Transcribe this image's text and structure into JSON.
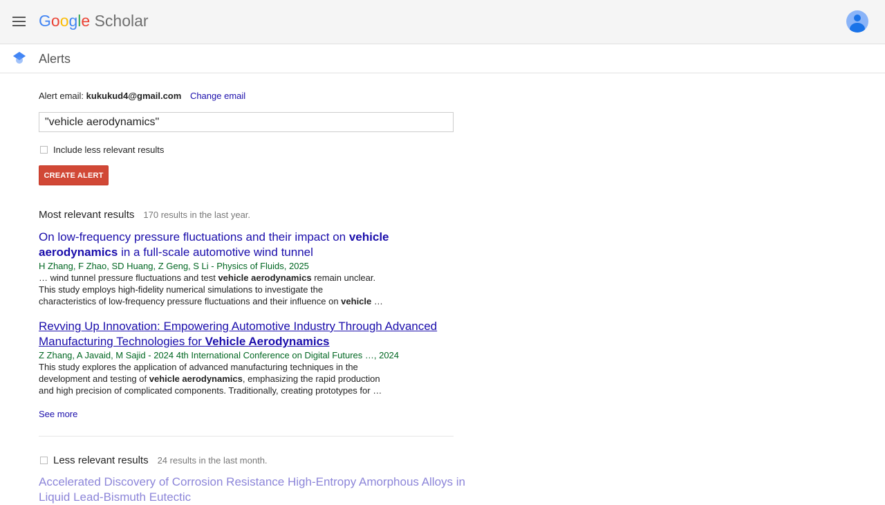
{
  "header": {
    "logo_google": [
      "G",
      "o",
      "o",
      "g",
      "l",
      "e"
    ],
    "logo_colors": [
      "#4285f4",
      "#ea4335",
      "#fbbc05",
      "#4285f4",
      "#34a853",
      "#ea4335"
    ],
    "logo_scholar": "Scholar"
  },
  "subheader": {
    "title": "Alerts"
  },
  "alert": {
    "email_label": "Alert email:",
    "email": "kukukud4@gmail.com",
    "change_email": "Change email",
    "query": "\"vehicle aerodynamics\"",
    "include_less_label": "Include less relevant results",
    "include_less_checked": false,
    "create_button": "CREATE ALERT"
  },
  "most_relevant": {
    "heading": "Most relevant results",
    "count": "170 results in the last year.",
    "results": [
      {
        "title_parts": [
          {
            "text": "On low-frequency pressure fluctuations and their impact on ",
            "bold": false
          },
          {
            "text": "vehicle aerodynamics",
            "bold": true
          },
          {
            "text": " in a full-scale automotive wind tunnel",
            "bold": false
          }
        ],
        "authors": "H Zhang, F Zhao, SD Huang, Z Geng, S Li - Physics of Fluids, 2025",
        "snippet_lines": [
          [
            {
              "text": "… wind tunnel pressure fluctuations and test ",
              "bold": false
            },
            {
              "text": "vehicle aerodynamics",
              "bold": true
            },
            {
              "text": " remain unclear.",
              "bold": false
            }
          ],
          [
            {
              "text": "This study employs high-fidelity numerical simulations to investigate the",
              "bold": false
            }
          ],
          [
            {
              "text": "characteristics of low-frequency pressure fluctuations and their influence on ",
              "bold": false
            },
            {
              "text": "vehicle",
              "bold": true
            },
            {
              "text": " …",
              "bold": false
            }
          ]
        ]
      },
      {
        "title_parts": [
          {
            "text": "Revving Up Innovation: Empowering Automotive Industry Through Advanced Manufacturing Technologies for ",
            "bold": false
          },
          {
            "text": "Vehicle Aerodynamics",
            "bold": true
          }
        ],
        "authors": "Z Zhang, A Javaid, M Sajid - 2024 4th International Conference on Digital Futures …, 2024",
        "snippet_lines": [
          [
            {
              "text": "This study explores the application of advanced manufacturing techniques in the",
              "bold": false
            }
          ],
          [
            {
              "text": "development and testing of ",
              "bold": false
            },
            {
              "text": "vehicle aerodynamics",
              "bold": true
            },
            {
              "text": ", emphasizing the rapid production",
              "bold": false
            }
          ],
          [
            {
              "text": "and high precision of complicated components. Traditionally, creating prototypes for …",
              "bold": false
            }
          ]
        ]
      }
    ],
    "see_more": "See more"
  },
  "less_relevant": {
    "heading": "Less relevant results",
    "count": "24 results in the last month.",
    "checked": false,
    "first_title": "Accelerated Discovery of Corrosion Resistance High-Entropy Amorphous Alloys in Liquid Lead-Bismuth Eutectic"
  }
}
